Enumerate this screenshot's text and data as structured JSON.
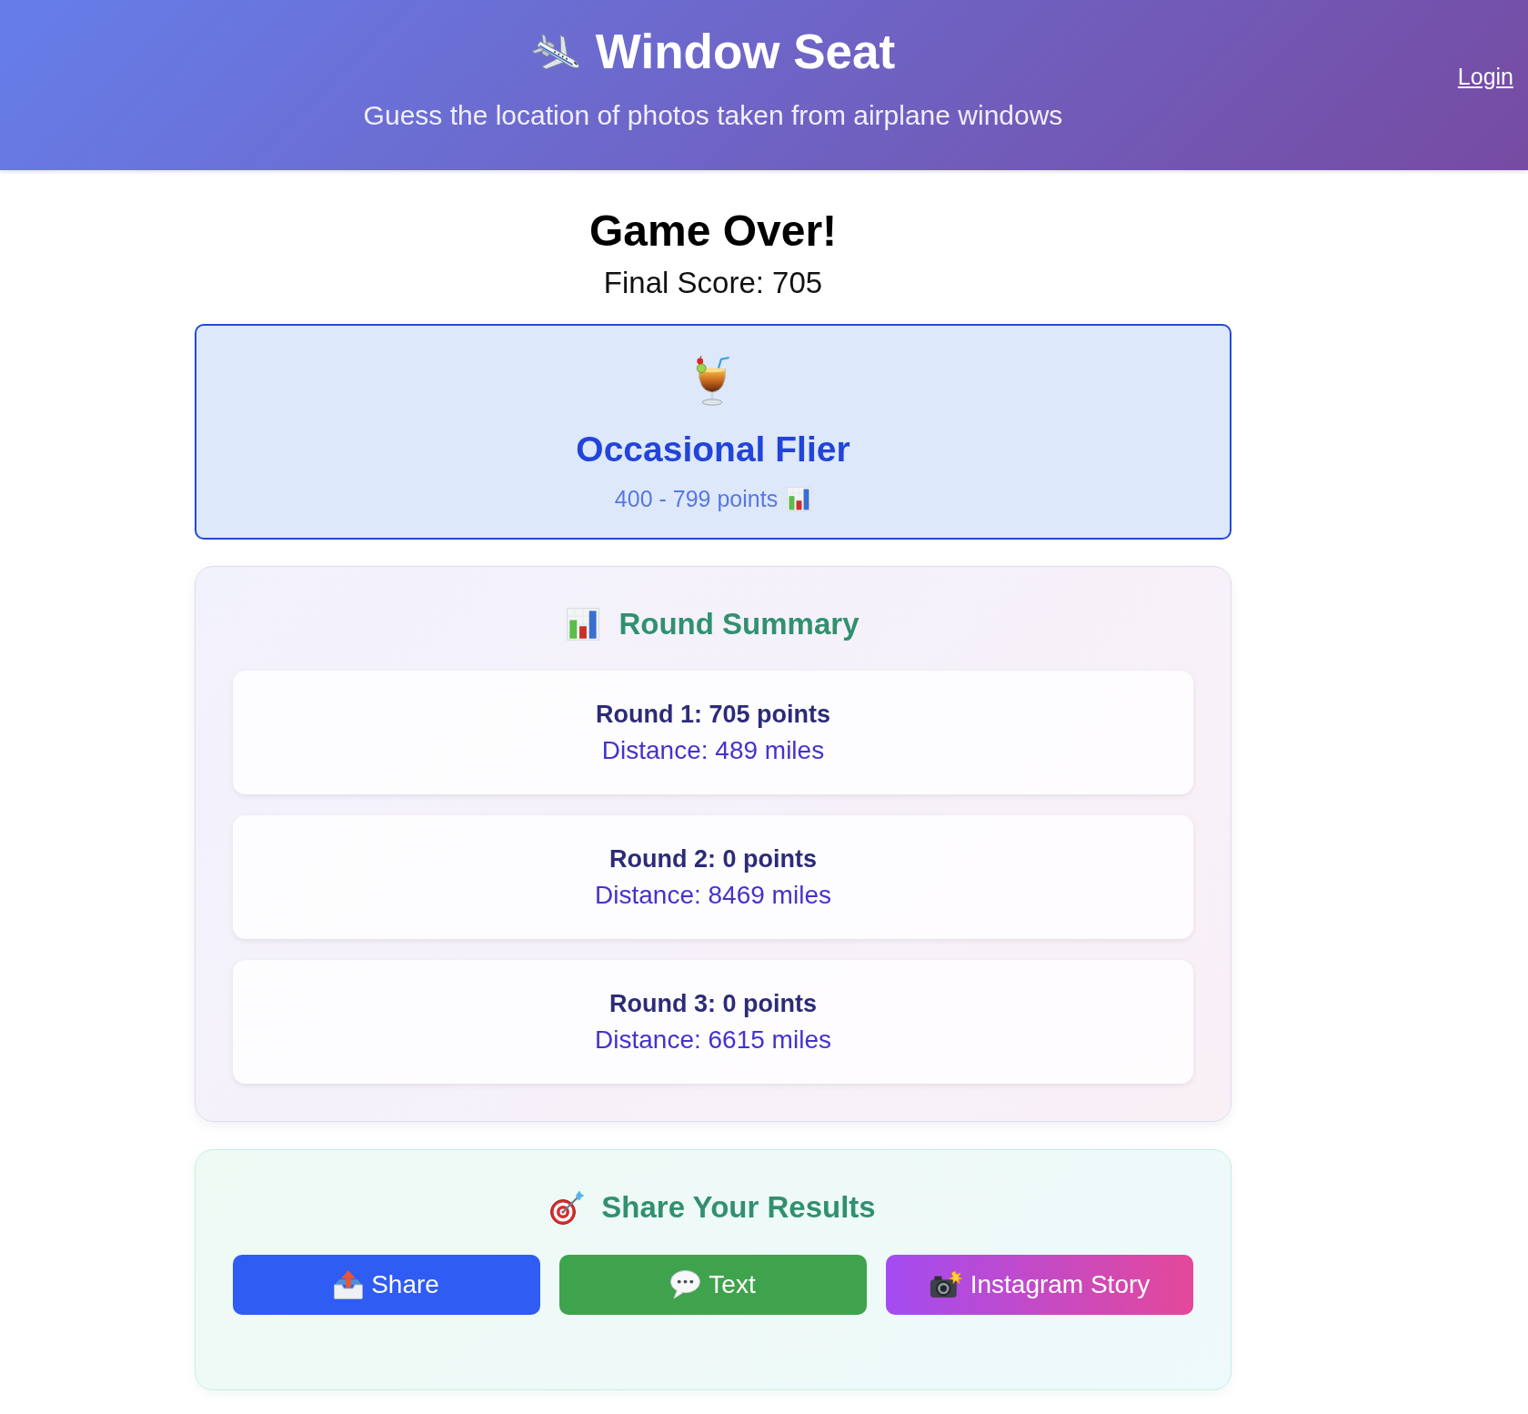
{
  "header": {
    "title": "Window Seat",
    "subtitle": "Guess the location of photos taken from airplane windows",
    "login": "Login"
  },
  "result": {
    "heading": "Game Over!",
    "final_score": "Final Score: 705"
  },
  "tier": {
    "name": "Occasional Flier",
    "range": "400 - 799 points"
  },
  "round_summary": {
    "title": "Round Summary",
    "rounds": [
      {
        "score": "Round 1: 705 points",
        "distance": "Distance: 489 miles"
      },
      {
        "score": "Round 2: 0 points",
        "distance": "Distance: 8469 miles"
      },
      {
        "score": "Round 3: 0 points",
        "distance": "Distance: 6615 miles"
      }
    ]
  },
  "share": {
    "title": "Share Your Results",
    "buttons": [
      {
        "kind": "share",
        "label": "Share"
      },
      {
        "kind": "text",
        "label": "Text"
      },
      {
        "kind": "story",
        "label": "Instagram Story"
      }
    ]
  }
}
